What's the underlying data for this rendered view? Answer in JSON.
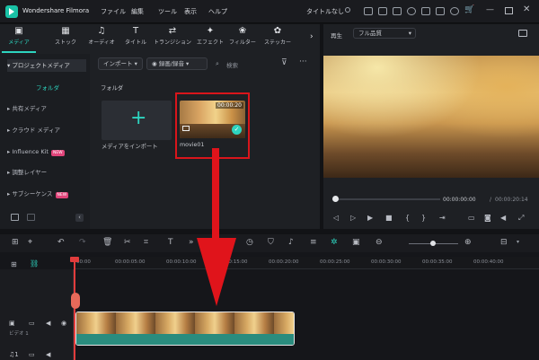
{
  "app": {
    "title": "Wondershare Filmora",
    "project_name": "タイトルなし"
  },
  "menu": [
    "ファイル",
    "編集",
    "ツール",
    "表示",
    "ヘルプ"
  ],
  "media_tabs": [
    {
      "label": "メディア",
      "icon": "media-icon"
    },
    {
      "label": "ストック",
      "icon": "stock-icon"
    },
    {
      "label": "オーディオ",
      "icon": "music-icon"
    },
    {
      "label": "タイトル",
      "icon": "title-icon"
    },
    {
      "label": "トランジション",
      "icon": "transition-icon"
    },
    {
      "label": "エフェクト",
      "icon": "effect-icon"
    },
    {
      "label": "フィルター",
      "icon": "filter-icon"
    },
    {
      "label": "ステッカー",
      "icon": "sticker-icon"
    }
  ],
  "sidebar": {
    "project_media": "プロジェクトメディア",
    "folder": "フォルダ",
    "shared_media": "共有メディア",
    "cloud_media": "クラウド メディア",
    "influence_kit": "Influence Kit",
    "adjustment_layer": "調整レイヤー",
    "subsequence": "サブシーケンス",
    "new_badge": "NEW"
  },
  "toolbar": {
    "import_label": "インポート",
    "record_label": "録画/録音",
    "search_placeholder": "検索"
  },
  "media": {
    "folder_label": "フォルダ",
    "import_tile_label": "メディアをインポート",
    "clip_name": "movie01",
    "clip_duration": "00:00:20"
  },
  "preview": {
    "label": "再生",
    "quality": "フル品質",
    "current_time": "00:00:00:00",
    "total_time": "00:00:20:14"
  },
  "timeline": {
    "ruler": [
      "00:00",
      "00:00:05:00",
      "00:00:10:00",
      "00:00:15:00",
      "00:00:20:00",
      "00:00:25:00",
      "00:00:30:00",
      "00:00:35:00",
      "00:00:40:00"
    ],
    "video_track_label": "ビデオ 1",
    "audio_track_label": "1"
  },
  "colors": {
    "accent": "#2dd4bf",
    "highlight_box": "#d9151b",
    "arrow": "#e0141b",
    "playhead": "#e13c3c"
  }
}
